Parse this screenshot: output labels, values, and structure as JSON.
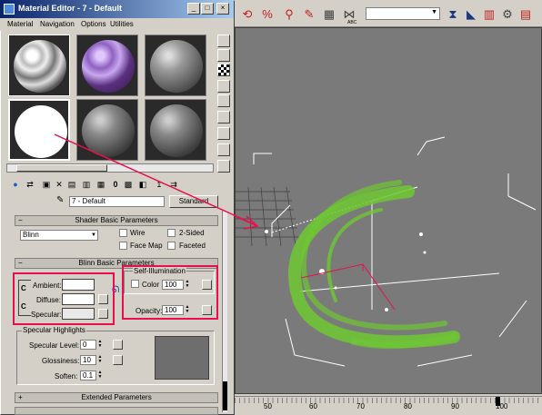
{
  "window": {
    "title": "Material Editor - 7 - Default",
    "min": "_",
    "restore": "□",
    "close": "×"
  },
  "menu": [
    "Material",
    "Navigation",
    "Options",
    "Utilities"
  ],
  "material": {
    "name": "7 - Default",
    "type_button": "Standard"
  },
  "rollouts": {
    "shader": "Shader Basic Parameters",
    "blinn": "Blinn Basic Parameters",
    "extended": "Extended Parameters"
  },
  "shader": {
    "type": "Blinn",
    "wire": "Wire",
    "two_sided": "2-Sided",
    "face_map": "Face Map",
    "faceted": "Faceted"
  },
  "self_illum": {
    "group": "Self-Illumination",
    "color_label": "Color",
    "value": "100"
  },
  "colors": {
    "ambient": "Ambient:",
    "diffuse": "Diffuse:",
    "specular": "Specular:",
    "lock": "C"
  },
  "opacity": {
    "label": "Opacity:",
    "value": "100"
  },
  "specular": {
    "group": "Specular Highlights",
    "level_label": "Specular Level:",
    "level": "0",
    "gloss_label": "Glossiness:",
    "gloss": "10",
    "soften_label": "Soften:",
    "soften": "0.1"
  },
  "toolbar": {
    "abc": "ABC"
  },
  "timeline": {
    "ticks": [
      "50",
      "60",
      "70",
      "80",
      "90",
      "100"
    ]
  },
  "accent": {
    "highlight": "#e8104c",
    "particles": "#6ec832"
  }
}
